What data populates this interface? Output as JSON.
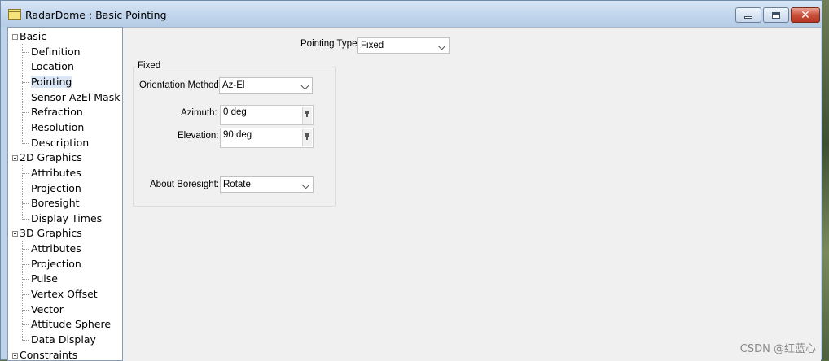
{
  "window": {
    "title": "RadarDome : Basic Pointing",
    "close_glyph": "✕"
  },
  "tree": {
    "groups": [
      {
        "label": "Basic",
        "items": [
          "Definition",
          "Location",
          "Pointing",
          "Sensor AzEl Mask",
          "Refraction",
          "Resolution",
          "Description"
        ]
      },
      {
        "label": "2D Graphics",
        "items": [
          "Attributes",
          "Projection",
          "Boresight",
          "Display Times"
        ]
      },
      {
        "label": "3D Graphics",
        "items": [
          "Attributes",
          "Projection",
          "Pulse",
          "Vertex Offset",
          "Vector",
          "Attitude Sphere",
          "Data Display"
        ]
      },
      {
        "label": "Constraints",
        "items": []
      }
    ],
    "selected": "Pointing"
  },
  "form": {
    "pointing_type_label": "Pointing Type:",
    "pointing_type_value": "Fixed",
    "group_title": "Fixed",
    "orientation_method_label": "Orientation Method:",
    "orientation_method_value": "Az-El",
    "azimuth_label": "Azimuth:",
    "azimuth_value": "0 deg",
    "elevation_label": "Elevation:",
    "elevation_value": "90 deg",
    "about_boresight_label": "About Boresight:",
    "about_boresight_value": "Rotate"
  },
  "watermark": "CSDN @红蓝心",
  "icons": {
    "app": "window-app-icon",
    "minimize": "minimize-icon",
    "maximize": "maximize-icon",
    "close": "close-icon"
  },
  "colors": {
    "titlebar": "#c3d7ed",
    "close_button": "#c9503a",
    "content_bg": "#f0f0f0",
    "selection": "#dbe6f4"
  }
}
